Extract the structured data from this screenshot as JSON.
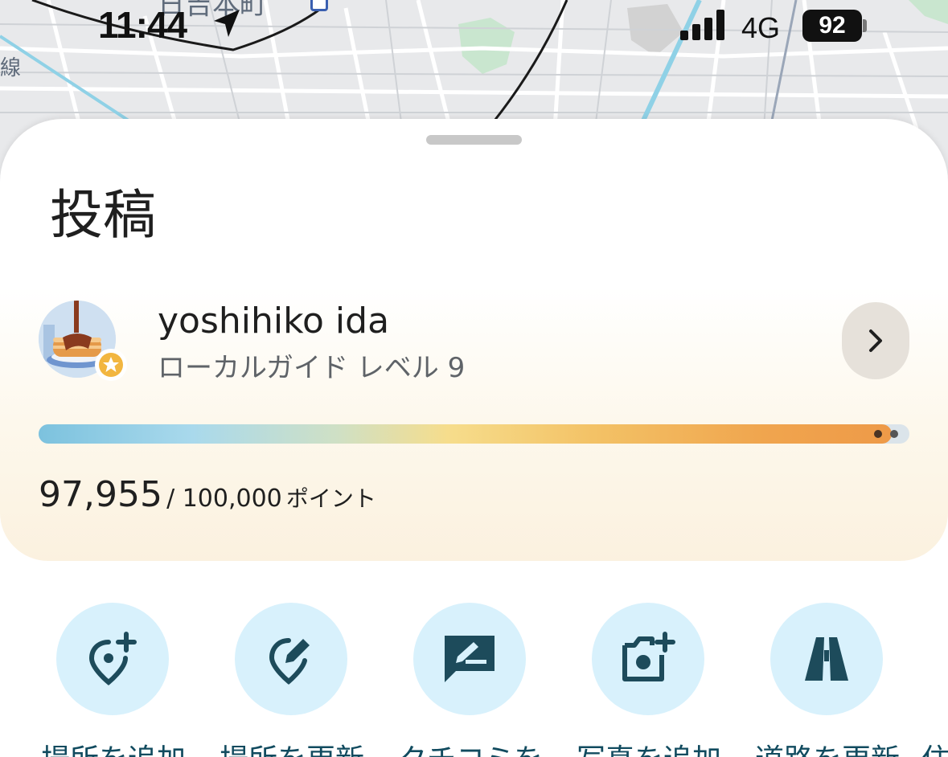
{
  "status_bar": {
    "time": "11:44",
    "network": "4G",
    "battery": "92"
  },
  "map": {
    "place_label": "日吉本町",
    "side_label": "線"
  },
  "sheet": {
    "title": "投稿"
  },
  "profile": {
    "name": "yoshihiko ida",
    "level": "ローカルガイド レベル 9",
    "points_current": "97,955",
    "points_total": "/ 100,000",
    "points_unit": "ポイント",
    "progress_fraction": 0.97955
  },
  "actions": [
    {
      "label": "場所を追加",
      "icon": "add-place-icon"
    },
    {
      "label": "場所を更新",
      "icon": "edit-place-icon"
    },
    {
      "label": "クチコミを",
      "icon": "write-review-icon"
    },
    {
      "label": "写真を追加",
      "icon": "add-photo-icon"
    },
    {
      "label": "道路を更新",
      "icon": "road-icon"
    },
    {
      "label": "住",
      "icon": ""
    }
  ],
  "colors": {
    "action_bg": "#d8f1fc",
    "action_icon": "#1d4b5b",
    "chevron_bg": "#e6e1da"
  }
}
